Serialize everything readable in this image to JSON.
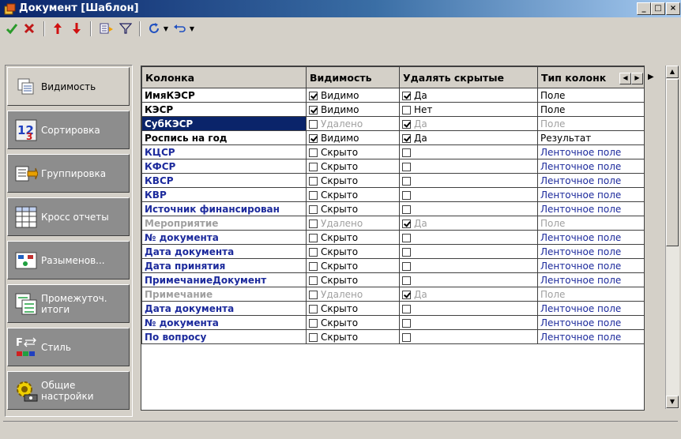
{
  "window": {
    "title": "Документ [Шаблон]"
  },
  "toolbar": {
    "items": [
      "check-icon",
      "cancel-icon",
      "move-up-icon",
      "move-down-icon",
      "columns-icon",
      "filter-icon",
      "refresh-icon",
      "undo-icon"
    ]
  },
  "sidebar": {
    "items": [
      {
        "label": "Видимость",
        "icon": "visibility-icon",
        "active": true
      },
      {
        "label": "Сортировка",
        "icon": "sort-icon",
        "active": false
      },
      {
        "label": "Группировка",
        "icon": "grouping-icon",
        "active": false
      },
      {
        "label": "Кросс отчеты",
        "icon": "cross-report-icon",
        "active": false
      },
      {
        "label": "Разыменов...",
        "icon": "dereference-icon",
        "active": false
      },
      {
        "label": "Промежуточ.\nитоги",
        "icon": "subtotals-icon",
        "active": false
      },
      {
        "label": "Стиль",
        "icon": "style-icon",
        "active": false
      },
      {
        "label": "Общие\nнастройки",
        "icon": "general-settings-icon",
        "active": false
      }
    ]
  },
  "grid": {
    "headers": [
      "Колонка",
      "Видимость",
      "Удалять скрытые",
      "Тип колонк"
    ],
    "rows": [
      {
        "name": "ИмяКЭСР",
        "vis_checked": true,
        "vis": "Видимо",
        "del_checked": true,
        "del": "Да",
        "type": "Поле",
        "style": "black"
      },
      {
        "name": "КЭСР",
        "vis_checked": true,
        "vis": "Видимо",
        "del_checked": false,
        "del": "Нет",
        "type": "Поле",
        "style": "black"
      },
      {
        "name": "СубКЭСР",
        "vis_checked": false,
        "vis": "Удалено",
        "del_checked": true,
        "del": "Да",
        "type": "Поле",
        "style": "selected"
      },
      {
        "name": "Роспись на год",
        "vis_checked": true,
        "vis": "Видимо",
        "del_checked": true,
        "del": "Да",
        "type": "Результат",
        "style": "black"
      },
      {
        "name": "КЦСР",
        "vis_checked": false,
        "vis": "Скрыто",
        "del_checked": false,
        "del": "",
        "type": "Ленточное поле",
        "style": "blue"
      },
      {
        "name": "КФСР",
        "vis_checked": false,
        "vis": "Скрыто",
        "del_checked": false,
        "del": "",
        "type": "Ленточное поле",
        "style": "blue"
      },
      {
        "name": "КВСР",
        "vis_checked": false,
        "vis": "Скрыто",
        "del_checked": false,
        "del": "",
        "type": "Ленточное поле",
        "style": "blue"
      },
      {
        "name": "КВР",
        "vis_checked": false,
        "vis": "Скрыто",
        "del_checked": false,
        "del": "",
        "type": "Ленточное поле",
        "style": "blue"
      },
      {
        "name": "Источник финансирован",
        "vis_checked": false,
        "vis": "Скрыто",
        "del_checked": false,
        "del": "",
        "type": "Ленточное поле",
        "style": "blue"
      },
      {
        "name": "Мероприятие",
        "vis_checked": false,
        "vis": "Удалено",
        "del_checked": true,
        "del": "Да",
        "type": "Поле",
        "style": "gray"
      },
      {
        "name": "№ документа",
        "vis_checked": false,
        "vis": "Скрыто",
        "del_checked": false,
        "del": "",
        "type": "Ленточное поле",
        "style": "blue"
      },
      {
        "name": "Дата документа",
        "vis_checked": false,
        "vis": "Скрыто",
        "del_checked": false,
        "del": "",
        "type": "Ленточное поле",
        "style": "blue"
      },
      {
        "name": "Дата принятия",
        "vis_checked": false,
        "vis": "Скрыто",
        "del_checked": false,
        "del": "",
        "type": "Ленточное поле",
        "style": "blue"
      },
      {
        "name": "ПримечаниеДокумент",
        "vis_checked": false,
        "vis": "Скрыто",
        "del_checked": false,
        "del": "",
        "type": "Ленточное поле",
        "style": "blue"
      },
      {
        "name": "Примечание",
        "vis_checked": false,
        "vis": "Удалено",
        "del_checked": true,
        "del": "Да",
        "type": "Поле",
        "style": "gray"
      },
      {
        "name": "Дата документа",
        "vis_checked": false,
        "vis": "Скрыто",
        "del_checked": false,
        "del": "",
        "type": "Ленточное поле",
        "style": "blue"
      },
      {
        "name": "№ документа",
        "vis_checked": false,
        "vis": "Скрыто",
        "del_checked": false,
        "del": "",
        "type": "Ленточное поле",
        "style": "blue"
      },
      {
        "name": "По вопросу",
        "vis_checked": false,
        "vis": "Скрыто",
        "del_checked": false,
        "del": "",
        "type": "Ленточное поле",
        "style": "blue"
      }
    ]
  }
}
